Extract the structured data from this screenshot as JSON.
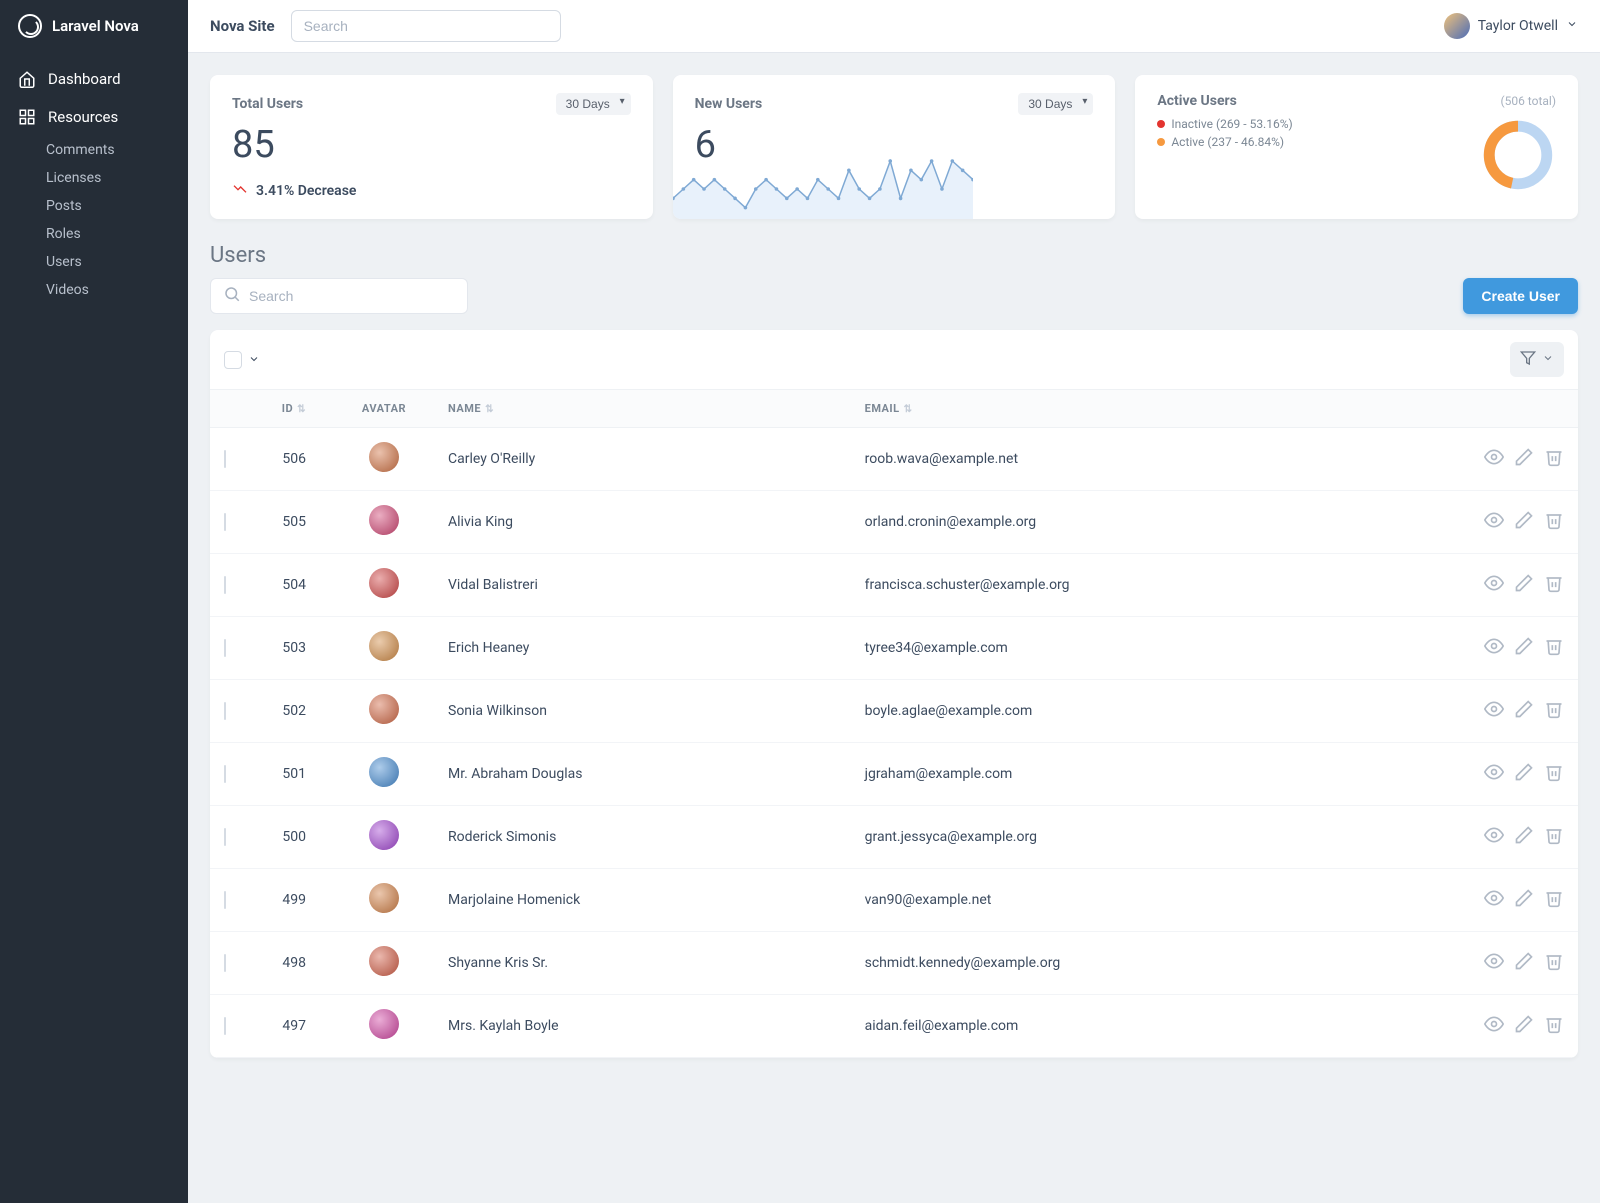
{
  "brand": "Laravel Nova",
  "site_name": "Nova Site",
  "global_search_placeholder": "Search",
  "user": {
    "name": "Taylor Otwell"
  },
  "nav": {
    "dashboard": "Dashboard",
    "resources": "Resources",
    "items": [
      "Comments",
      "Licenses",
      "Posts",
      "Roles",
      "Users",
      "Videos"
    ]
  },
  "cards": {
    "total_users": {
      "title": "Total Users",
      "range": "30 Days",
      "value": "85",
      "trend": "3.41% Decrease"
    },
    "new_users": {
      "title": "New Users",
      "range": "30 Days",
      "value": "6"
    },
    "active_users": {
      "title": "Active Users",
      "total": "(506 total)",
      "inactive_label": "Inactive (269 - 53.16%)",
      "active_label": "Active (237 - 46.84%)",
      "inactive_pct": 53.16,
      "active_pct": 46.84
    }
  },
  "users_section": {
    "title": "Users",
    "search_placeholder": "Search",
    "create_label": "Create User",
    "columns": {
      "id": "ID",
      "avatar": "Avatar",
      "name": "Name",
      "email": "Email"
    }
  },
  "users": [
    {
      "id": "506",
      "name": "Carley O'Reilly",
      "email": "roob.wava@example.net",
      "hue": 20
    },
    {
      "id": "505",
      "name": "Alivia King",
      "email": "orland.cronin@example.org",
      "hue": 340
    },
    {
      "id": "504",
      "name": "Vidal Balistreri",
      "email": "francisca.schuster@example.org",
      "hue": 0
    },
    {
      "id": "503",
      "name": "Erich Heaney",
      "email": "tyree34@example.com",
      "hue": 30
    },
    {
      "id": "502",
      "name": "Sonia Wilkinson",
      "email": "boyle.aglae@example.com",
      "hue": 15
    },
    {
      "id": "501",
      "name": "Mr. Abraham Douglas",
      "email": "jgraham@example.com",
      "hue": 210
    },
    {
      "id": "500",
      "name": "Roderick Simonis",
      "email": "grant.jessyca@example.org",
      "hue": 280
    },
    {
      "id": "499",
      "name": "Marjolaine Homenick",
      "email": "van90@example.net",
      "hue": 25
    },
    {
      "id": "498",
      "name": "Shyanne Kris Sr.",
      "email": "schmidt.kennedy@example.org",
      "hue": 10
    },
    {
      "id": "497",
      "name": "Mrs. Kaylah Boyle",
      "email": "aidan.feil@example.com",
      "hue": 320
    }
  ],
  "chart_data": {
    "type": "line",
    "title": "New Users (30 Days)",
    "x": [
      1,
      2,
      3,
      4,
      5,
      6,
      7,
      8,
      9,
      10,
      11,
      12,
      13,
      14,
      15,
      16,
      17,
      18,
      19,
      20,
      21,
      22,
      23,
      24,
      25,
      26,
      27,
      28,
      29,
      30
    ],
    "values": [
      2,
      3,
      4,
      3,
      4,
      3,
      2,
      1,
      3,
      4,
      3,
      2,
      3,
      2,
      4,
      3,
      2,
      5,
      3,
      2,
      3,
      6,
      2,
      5,
      4,
      6,
      3,
      6,
      5,
      4
    ]
  }
}
